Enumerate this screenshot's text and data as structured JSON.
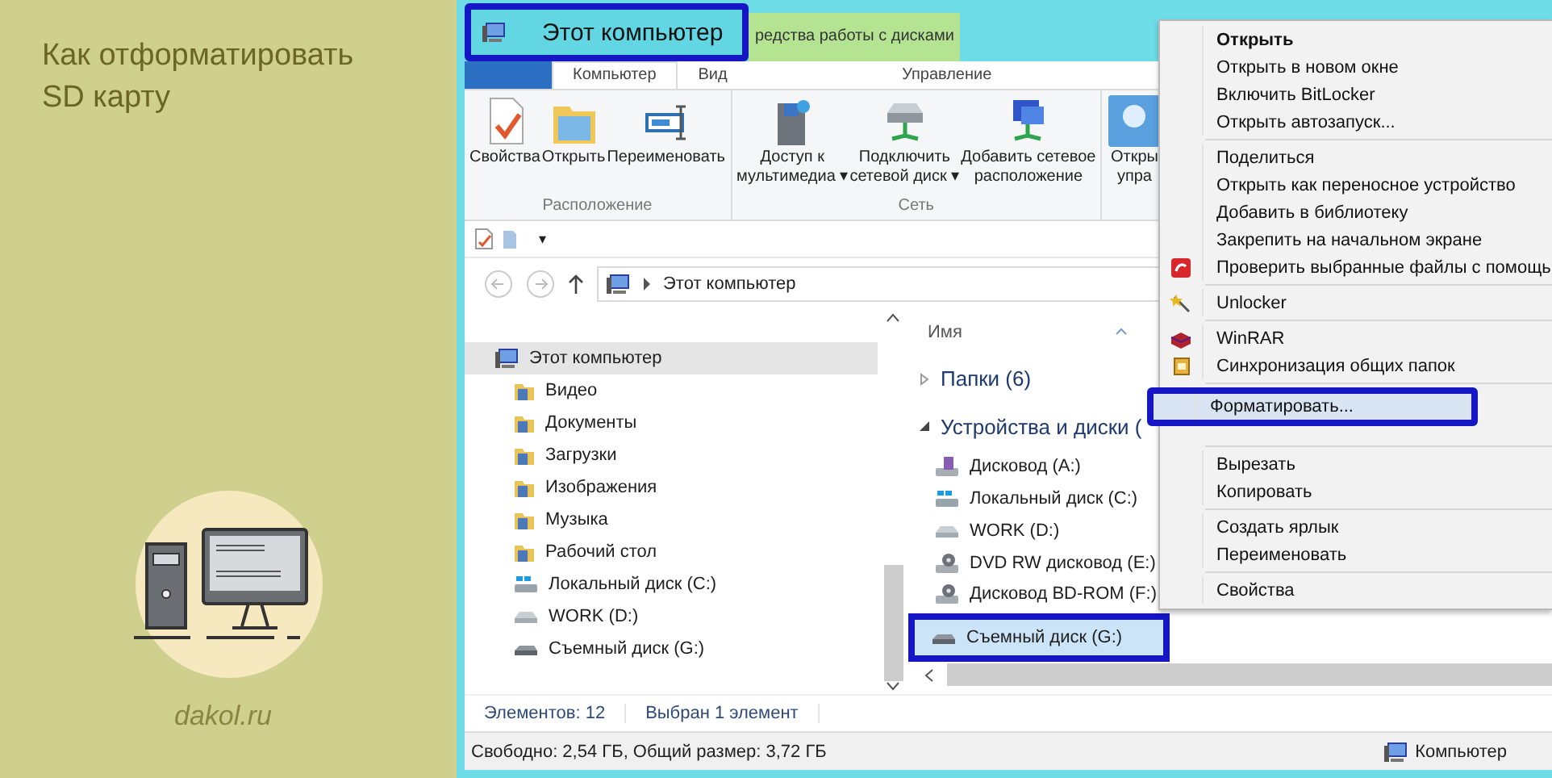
{
  "sidebar": {
    "title": "Как отформатировать SD карту",
    "site": "dakol.ru"
  },
  "window": {
    "title": "Этот компьютер",
    "title_highlighted": true,
    "context_tab": "редства работы с дисками"
  },
  "ribbon_tabs": [
    {
      "label": "Компьютер",
      "selected": true
    },
    {
      "label": "Вид",
      "selected": false
    },
    {
      "label": "Управление",
      "selected": false
    }
  ],
  "ribbon_groups": [
    {
      "label": "Расположение",
      "buttons": [
        {
          "kind": "properties",
          "lines": [
            "Свойства"
          ]
        },
        {
          "kind": "open",
          "lines": [
            "Открыть"
          ]
        },
        {
          "kind": "rename",
          "lines": [
            "Переименовать"
          ]
        }
      ]
    },
    {
      "label": "Сеть",
      "buttons": [
        {
          "kind": "media",
          "lines": [
            "Доступ к",
            "мультимедиа ▾"
          ]
        },
        {
          "kind": "netdrive",
          "lines": [
            "Подключить",
            "сетевой диск ▾"
          ]
        },
        {
          "kind": "netplace",
          "lines": [
            "Добавить сетевое",
            "расположение"
          ]
        }
      ]
    },
    {
      "buttons": [
        {
          "kind": "panel",
          "lines": [
            "Откры",
            "упра"
          ]
        }
      ]
    }
  ],
  "quick_access": {
    "menu": "▾"
  },
  "address": {
    "path": "Этот компьютер"
  },
  "nav_tree": [
    {
      "label": "Этот компьютер",
      "kind": "computer",
      "selected": true,
      "children": [
        {
          "label": "Видео",
          "kind": "folder",
          "selected": false
        },
        {
          "label": "Документы",
          "kind": "folder",
          "selected": false
        },
        {
          "label": "Загрузки",
          "kind": "folder",
          "selected": false
        },
        {
          "label": "Изображения",
          "kind": "folder",
          "selected": false
        },
        {
          "label": "Музыка",
          "kind": "folder",
          "selected": false
        },
        {
          "label": "Рабочий стол",
          "kind": "folder",
          "selected": false
        },
        {
          "label": "Локальный диск (C:)",
          "kind": "system",
          "selected": false
        },
        {
          "label": "WORK (D:)",
          "kind": "drive",
          "selected": false
        },
        {
          "label": "Съемный диск (G:)",
          "kind": "removable",
          "selected": false
        }
      ]
    }
  ],
  "content": {
    "column": "Имя",
    "groups": [
      {
        "label": "Папки (6)",
        "expanded": false
      },
      {
        "label": "Устройства и диски (",
        "expanded": true,
        "items": [
          {
            "label": "Дисковод (A:)",
            "kind": "floppy",
            "selected": false,
            "highlighted": false
          },
          {
            "label": "Локальный диск (C:)",
            "kind": "system",
            "selected": false,
            "highlighted": false
          },
          {
            "label": "WORK (D:)",
            "kind": "drive",
            "selected": false,
            "highlighted": false
          },
          {
            "label": "DVD RW дисковод (E:)",
            "kind": "optical",
            "selected": false,
            "highlighted": false
          },
          {
            "label": "Дисковод BD-ROM (F:)",
            "kind": "optical",
            "selected": false,
            "highlighted": false
          },
          {
            "label": "Съемный диск (G:)",
            "kind": "removable",
            "selected": true,
            "highlighted": true
          }
        ]
      }
    ]
  },
  "status_bar": [
    "Элементов: 12",
    "Выбран 1 элемент"
  ],
  "details_bar": {
    "text": "Свободно: 2,54 ГБ, Общий размер: 3,72 ГБ",
    "location": "Компьютер"
  },
  "context_menu": {
    "sections": [
      [
        {
          "label": "Открыть",
          "default": true,
          "selected": false,
          "highlighted": false
        },
        {
          "label": "Открыть в новом окне",
          "default": false,
          "selected": false,
          "highlighted": false
        },
        {
          "label": "Включить BitLocker",
          "default": false,
          "selected": false,
          "highlighted": false
        },
        {
          "label": "Открыть автозапуск...",
          "default": false,
          "selected": false,
          "highlighted": false
        }
      ],
      [
        {
          "label": "Поделиться",
          "default": false,
          "selected": false,
          "highlighted": false
        },
        {
          "label": "Открыть как переносное устройство",
          "default": false,
          "selected": false,
          "highlighted": false
        },
        {
          "label": "Добавить в библиотеку",
          "default": false,
          "selected": false,
          "highlighted": false
        },
        {
          "label": "Закрепить на начальном экране",
          "default": false,
          "selected": false,
          "highlighted": false
        },
        {
          "label": "Проверить выбранные файлы с помощь",
          "kind": "antivirus",
          "default": false,
          "selected": false,
          "highlighted": false
        }
      ],
      [
        {
          "label": "Unlocker",
          "kind": "wand",
          "default": false,
          "selected": false,
          "highlighted": false
        }
      ],
      [
        {
          "label": "WinRAR",
          "kind": "archive",
          "default": false,
          "selected": false,
          "highlighted": false
        },
        {
          "label": "Синхронизация общих папок",
          "kind": "sync",
          "default": false,
          "selected": false,
          "highlighted": false
        }
      ],
      [
        {
          "label": "Форматировать...",
          "default": false,
          "selected": true,
          "highlighted": true
        }
      ],
      [
        {
          "label": "Вырезать",
          "default": false,
          "selected": false,
          "highlighted": false
        },
        {
          "label": "Копировать",
          "default": false,
          "selected": false,
          "highlighted": false
        }
      ],
      [
        {
          "label": "Создать ярлык",
          "default": false,
          "selected": false,
          "highlighted": false
        },
        {
          "label": "Переименовать",
          "default": false,
          "selected": false,
          "highlighted": false
        }
      ],
      [
        {
          "label": "Свойства",
          "default": false,
          "selected": false,
          "highlighted": false
        }
      ]
    ]
  }
}
